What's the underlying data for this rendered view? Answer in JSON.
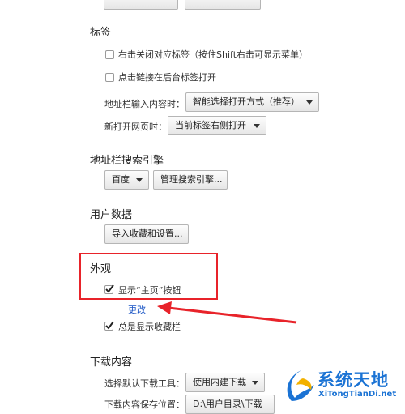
{
  "sections": {
    "tabs": {
      "title": "标签",
      "opt_right_close": "右击关闭对应标签（按住Shift右击可显示菜单）",
      "opt_bg_open": "点击链接在后台标签打开",
      "addr_input_label": "地址栏输入内容时：",
      "addr_input_value": "智能选择打开方式（推荐）",
      "new_page_label": "新打开网页时：",
      "new_page_value": "当前标签右侧打开"
    },
    "search": {
      "title": "地址栏搜索引擎",
      "engine_value": "百度",
      "manage_button": "管理搜索引擎..."
    },
    "userdata": {
      "title": "用户数据",
      "import_button": "导入收藏和设置..."
    },
    "appearance": {
      "title": "外观",
      "show_home_label": "显示“主页”按钮",
      "change_link": "更改",
      "show_bookmarks_label": "总是显示收藏栏"
    },
    "downloads": {
      "title": "下载内容",
      "tool_label": "选择默认下载工具：",
      "tool_value": "使用内建下载",
      "path_label": "下载内容保存位置：",
      "path_value": "D:\\用户目录\\下载"
    }
  },
  "watermark": {
    "title": "系统天地",
    "url": "XiTongTianDi.net"
  },
  "colors": {
    "highlight": "#e8232a",
    "link": "#1a55c5",
    "watermark_blue": "#1b73d4"
  }
}
